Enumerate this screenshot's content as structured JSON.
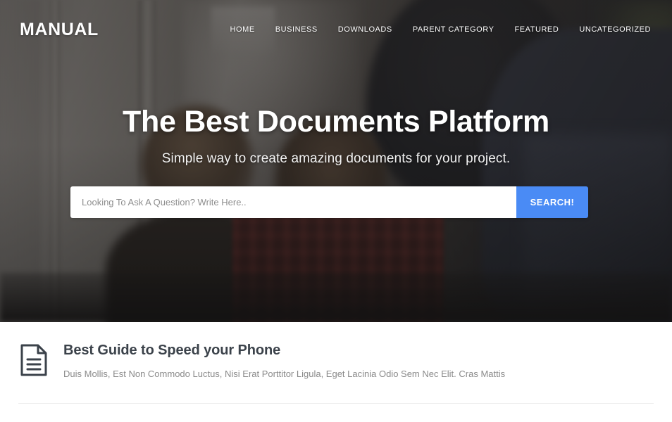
{
  "site": {
    "logo": "MANUAL",
    "accent_color": "#4a8bf5",
    "heading_color": "#3b424a",
    "body_text_color": "#8a8a8a"
  },
  "nav": {
    "items": [
      {
        "label": "HOME"
      },
      {
        "label": "BUSINESS"
      },
      {
        "label": "DOWNLOADS"
      },
      {
        "label": "PARENT CATEGORY"
      },
      {
        "label": "FEATURED"
      },
      {
        "label": "UNCATEGORIZED"
      }
    ]
  },
  "hero": {
    "title": "The Best Documents Platform",
    "subtitle": "Simple way to create amazing documents for your project.",
    "search": {
      "placeholder": "Looking To Ask A Question? Write Here..",
      "value": "",
      "button_label": "SEARCH!"
    }
  },
  "posts": [
    {
      "icon": "document-icon",
      "title": "Best Guide to Speed your Phone",
      "excerpt": "Duis Mollis, Est Non Commodo Luctus, Nisi Erat Porttitor Ligula, Eget Lacinia Odio Sem Nec Elit. Cras Mattis"
    }
  ]
}
